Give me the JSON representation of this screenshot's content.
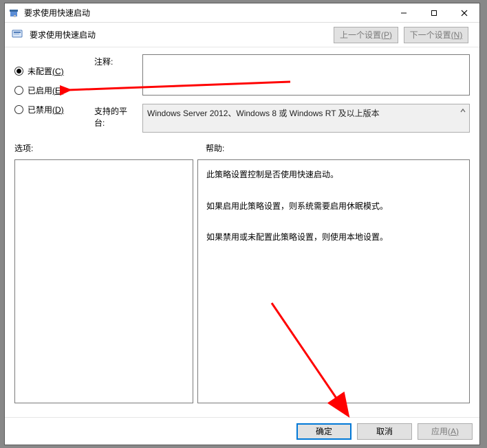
{
  "titlebar": {
    "title": "要求使用快速启动"
  },
  "toolbar": {
    "title": "要求使用快速启动",
    "prev_label": "上一个设置",
    "prev_accel": "(P)",
    "next_label": "下一个设置",
    "next_accel": "(N)"
  },
  "radios": {
    "not_configured": {
      "label": "未配置",
      "accel": "(C)"
    },
    "enabled": {
      "label": "已启用",
      "accel": "(E)"
    },
    "disabled": {
      "label": "已禁用",
      "accel": "(D)"
    },
    "selected": "not_configured"
  },
  "fields": {
    "comment_label": "注释:",
    "platform_label": "支持的平台:",
    "platform_value": "Windows Server 2012、Windows 8 或 Windows RT 及以上版本"
  },
  "mid": {
    "options_label": "选项:",
    "help_label": "帮助:"
  },
  "help": {
    "p1": "此策略设置控制是否使用快速启动。",
    "p2": "如果启用此策略设置，则系统需要启用休眠模式。",
    "p3": "如果禁用或未配置此策略设置，则使用本地设置。"
  },
  "footer": {
    "ok": "确定",
    "cancel": "取消",
    "apply": "应用",
    "apply_accel": "(A)"
  }
}
